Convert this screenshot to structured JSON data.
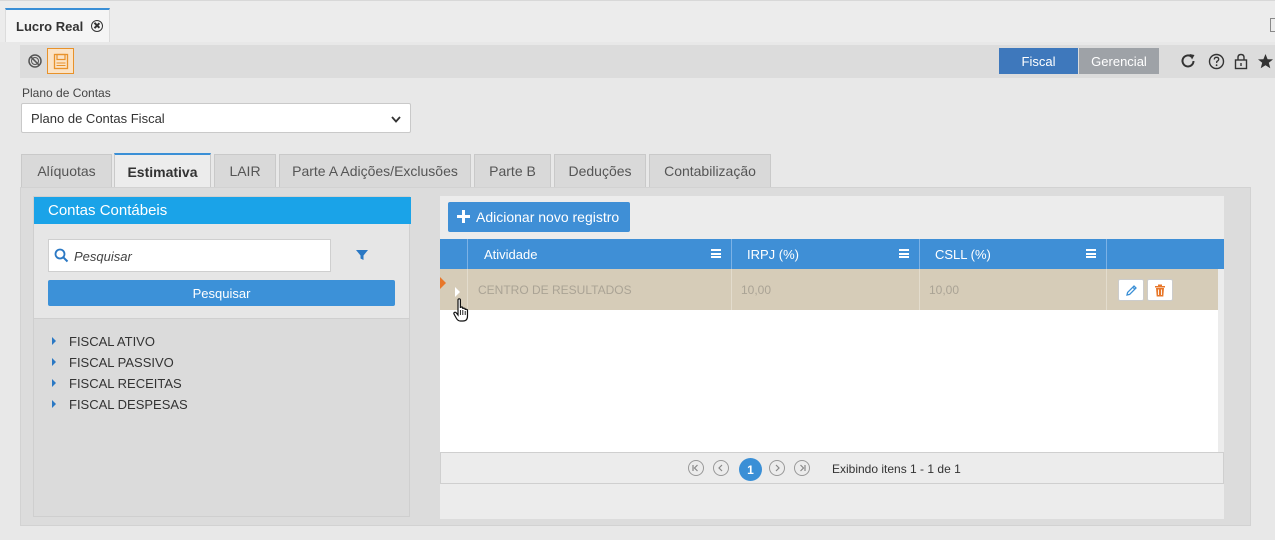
{
  "document_tab": {
    "title": "Lucro Real"
  },
  "toolbar": {
    "modes": {
      "fiscal": "Fiscal",
      "gerencial": "Gerencial"
    },
    "icons": [
      "cancel-icon",
      "save-icon",
      "refresh-icon",
      "help-icon",
      "lock-icon",
      "star-icon"
    ]
  },
  "plano": {
    "label": "Plano de Contas",
    "selected": "Plano de Contas Fiscal"
  },
  "tabs": [
    {
      "label": "Alíquotas"
    },
    {
      "label": "Estimativa"
    },
    {
      "label": "LAIR"
    },
    {
      "label": "Parte A Adições/Exclusões"
    },
    {
      "label": "Parte B"
    },
    {
      "label": "Deduções"
    },
    {
      "label": "Contabilização"
    }
  ],
  "active_tab": "Estimativa",
  "contas": {
    "title": "Contas Contábeis",
    "search_placeholder": "Pesquisar",
    "search_button": "Pesquisar",
    "tree": [
      {
        "label": "FISCAL ATIVO"
      },
      {
        "label": "FISCAL PASSIVO"
      },
      {
        "label": "FISCAL RECEITAS"
      },
      {
        "label": "FISCAL DESPESAS"
      }
    ]
  },
  "grid": {
    "add_button": "Adicionar novo registro",
    "columns": [
      "Atividade",
      "IRPJ (%)",
      "CSLL (%)"
    ],
    "rows": [
      {
        "atividade": "CENTRO DE RESULTADOS",
        "irpj": "10,00",
        "csll": "10,00"
      }
    ],
    "pager": {
      "current_page": "1",
      "info": "Exibindo itens 1 - 1 de 1"
    }
  },
  "colors": {
    "accent": "#3f8fd6",
    "header_blue": "#1aa3e8",
    "selected_row": "#d6ccb8",
    "save_orange": "#e8922a"
  }
}
